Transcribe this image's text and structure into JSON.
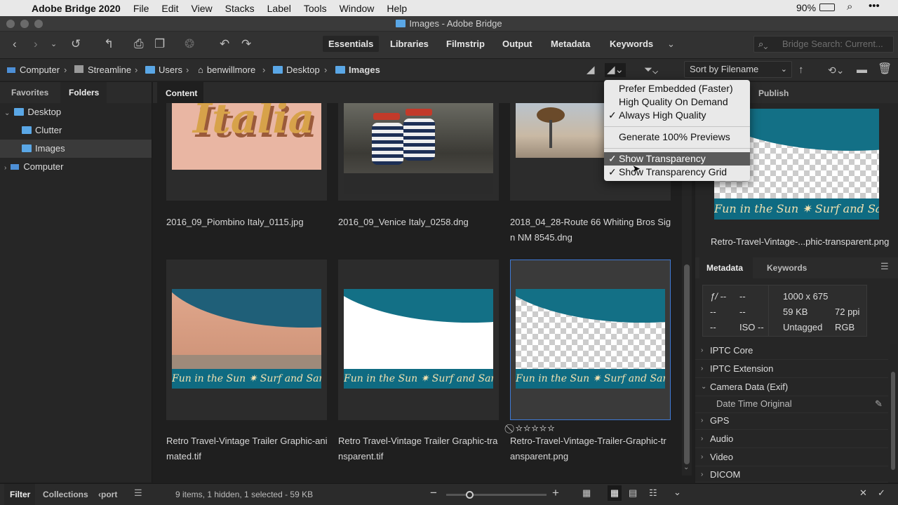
{
  "menubar": {
    "app": "Adobe Bridge 2020",
    "items": [
      "File",
      "Edit",
      "View",
      "Stacks",
      "Label",
      "Tools",
      "Window",
      "Help"
    ],
    "battery": "90%"
  },
  "window": {
    "title": "Images - Adobe Bridge"
  },
  "workspaces": [
    "Essentials",
    "Libraries",
    "Filmstrip",
    "Output",
    "Metadata",
    "Keywords"
  ],
  "search": {
    "placeholder": "Bridge Search: Current..."
  },
  "path": {
    "computer": "Computer",
    "volume": "Streamline",
    "users": "Users",
    "user": "benwillmore",
    "desktop": "Desktop",
    "images": "Images"
  },
  "sort": {
    "label": "Sort by Filename"
  },
  "left": {
    "tab_favorites": "Favorites",
    "tab_folders": "Folders",
    "tree": {
      "desktop": "Desktop",
      "clutter": "Clutter",
      "images": "Images",
      "computer": "Computer"
    }
  },
  "content": {
    "tab": "Content",
    "items": [
      {
        "name_l1": "2016_09_Piombino Italy_0115.jpg",
        "name_l2": ""
      },
      {
        "name_l1": "2016_09_Venice Italy_0258.dng",
        "name_l2": ""
      },
      {
        "name_l1": "2018_04_28-Route 66 Whiting Bros Sig",
        "name_l2": "n NM 8545.dng"
      },
      {
        "name_l1": "Retro Travel-Vintage Trailer Graphic-ani",
        "name_l2": "mated.tif"
      },
      {
        "name_l1": "Retro Travel-Vintage Trailer Graphic-tra",
        "name_l2": "nsparent.tif"
      },
      {
        "name_l1": "Retro-Travel-Vintage-Trailer-Graphic-tr",
        "name_l2": "ansparent.png"
      }
    ],
    "retro_text": "Fun in the Sun ✷ Surf and Sand",
    "stars": "⃠ ☆☆☆☆☆"
  },
  "dropdown": {
    "items": [
      {
        "label": "Prefer Embedded (Faster)",
        "checked": false
      },
      {
        "label": "High Quality On Demand",
        "checked": false
      },
      {
        "label": "Always High Quality",
        "checked": true
      },
      {
        "label": "Generate 100% Previews",
        "checked": false
      },
      {
        "label": "Show Transparency",
        "checked": true
      },
      {
        "label": "Show Transparency Grid",
        "checked": true
      }
    ],
    "check": "✓"
  },
  "preview": {
    "tab": "Publish",
    "filename": "Retro-Travel-Vintage-...phic-transparent.png"
  },
  "metadata": {
    "tab_metadata": "Metadata",
    "tab_keywords": "Keywords",
    "f": "ƒ/ --",
    "shutter": "--",
    "c1": "--",
    "c2": "--",
    "c3": "--",
    "iso": "ISO --",
    "dims": "1000 x 675",
    "size": "59 KB",
    "ppi": "72 ppi",
    "tag": "Untagged",
    "mode": "RGB",
    "sections": [
      "IPTC Core",
      "IPTC Extension",
      "Camera Data (Exif)",
      "GPS",
      "Audio",
      "Video",
      "DICOM"
    ],
    "exif_field": "Date Time Original"
  },
  "bottom": {
    "filter": "Filter",
    "collections": "Collections",
    "export": "‹port",
    "status": "9 items, 1 hidden, 1 selected - 59 KB"
  }
}
